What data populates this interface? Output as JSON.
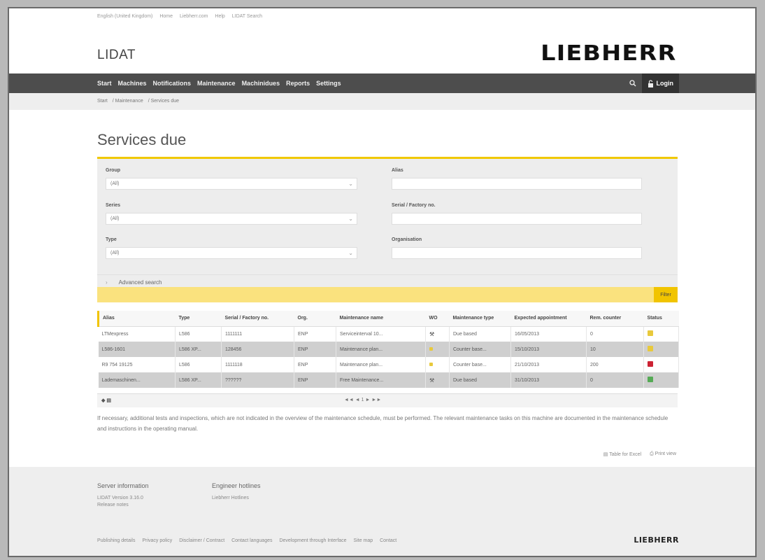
{
  "top_links": [
    "English (United Kingdom)",
    "Home",
    "Liebherr.com",
    "Help",
    "LIDAT Search"
  ],
  "app_title": "LIDAT",
  "brand": "LIEBHERR",
  "nav": {
    "items": [
      "Start",
      "Machines",
      "Notifications",
      "Maintenance",
      "Machinidues",
      "Reports",
      "Settings"
    ],
    "login": "Login"
  },
  "breadcrumb": [
    "Start",
    "/ Maintenance",
    "/ Services due"
  ],
  "page_title": "Services due",
  "search": {
    "fields_left": [
      {
        "label": "Group",
        "value": "(All)"
      },
      {
        "label": "Series",
        "value": "(All)"
      },
      {
        "label": "Type",
        "value": "(All)"
      }
    ],
    "fields_right": [
      {
        "label": "Alias",
        "value": ""
      },
      {
        "label": "Serial / Factory no.",
        "value": ""
      },
      {
        "label": "Organisation",
        "value": ""
      }
    ],
    "advanced": "Advanced search"
  },
  "filter_label": "Filter",
  "table": {
    "columns": [
      "Alias",
      "Type",
      "Serial / Factory no.",
      "Org.",
      "Maintenance name",
      "WO",
      "Maintenance type",
      "Expected appointment",
      "Rem. counter",
      "Status"
    ],
    "rows": [
      {
        "alias": "LTMexpress",
        "type": "L586",
        "serial": "1111111",
        "org": "ENP",
        "name": "Serviceinterval 10...",
        "wo": "⚒",
        "mtype": "Due based",
        "date": "16/05/2013",
        "counter": "0",
        "status_color": "#e8c93c",
        "shaded": false
      },
      {
        "alias": "L586-1601",
        "type": "L586 XP...",
        "serial": "128456",
        "org": "ENP",
        "name": "Maintenance plan...",
        "wo": "",
        "mtype": "Counter base...",
        "date": "15/10/2013",
        "counter": "10",
        "status_color": "#e8c93c",
        "shaded": true
      },
      {
        "alias": "R9 754 19125",
        "type": "L586",
        "serial": "1111118",
        "org": "ENP",
        "name": "Maintenance plan...",
        "wo": "",
        "mtype": "Counter base...",
        "date": "21/10/2013",
        "counter": "200",
        "status_color": "#cc2233",
        "shaded": false
      },
      {
        "alias": "Lademaschinen...",
        "type": "L586 XP...",
        "serial": "??????",
        "org": "ENP",
        "name": "Free Maintenance...",
        "wo": "⚒",
        "mtype": "Due based",
        "date": "31/10/2013",
        "counter": "0",
        "status_color": "#55aa55",
        "shaded": true
      }
    ],
    "foot_left": "◆ ▤",
    "foot_mid": "◄◄ ◄   1   ► ►►"
  },
  "note": "If necessary, additional tests and inspections, which are not indicated in the overview of the maintenance schedule, must be performed. The relevant maintenance tasks on this machine are documented in the maintenance schedule and instructions in the operating manual.",
  "tools": [
    "Table for Excel",
    "Print view"
  ],
  "footer": {
    "col1": {
      "heading": "Server information",
      "lines": [
        "LIDAT Version 3.16.0",
        "Release notes"
      ]
    },
    "col2": {
      "heading": "Engineer hotlines",
      "lines": [
        "Liebherr Hotlines"
      ]
    },
    "links": [
      "Publishing details",
      "Privacy policy",
      "Disclaimer / Contract",
      "Contact languages",
      "Development through Interface",
      "Site map",
      "Contact"
    ],
    "brand": "LIEBHERR"
  }
}
